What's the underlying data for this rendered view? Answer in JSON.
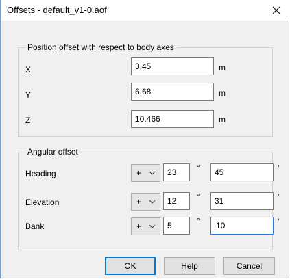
{
  "window": {
    "title": "Offsets - default_v1-0.aof"
  },
  "position_group": {
    "legend": "Position offset with respect to body axes",
    "rows": [
      {
        "label": "X",
        "value": "3.45",
        "unit": "m"
      },
      {
        "label": "Y",
        "value": "6.68",
        "unit": "m"
      },
      {
        "label": "Z",
        "value": "10.466",
        "unit": "m"
      }
    ]
  },
  "angular_group": {
    "legend": "Angular offset",
    "degree_symbol": "°",
    "minute_symbol": "'",
    "rows": [
      {
        "label": "Heading",
        "sign": "+",
        "degrees": "23",
        "minutes": "45"
      },
      {
        "label": "Elevation",
        "sign": "+",
        "degrees": "12",
        "minutes": "31"
      },
      {
        "label": "Bank",
        "sign": "+",
        "degrees": "5",
        "minutes": "10"
      }
    ]
  },
  "buttons": {
    "ok": "OK",
    "help": "Help",
    "cancel": "Cancel"
  },
  "colors": {
    "focus_border": "#2f7ad2",
    "default_button_border": "#0078d7",
    "window_border": "#7a9cc4"
  }
}
